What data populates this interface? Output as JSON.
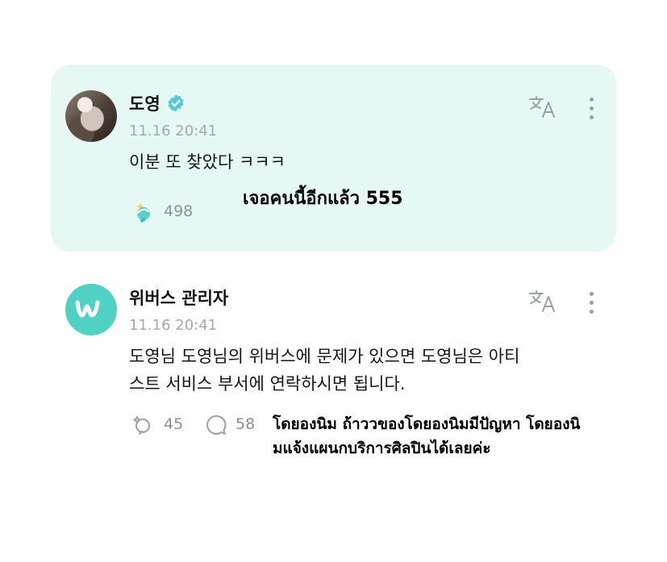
{
  "comment": {
    "author": "도영",
    "verified_icon": "verified-badge-icon",
    "timestamp": "11.16 20:41",
    "text": "이분 또 찾았다 ㅋㅋㅋ",
    "translation_overlay": "เจอคนนี้อีกแล้ว 555",
    "like_count": "498",
    "translate_icon": "translate-icon",
    "more_icon": "more-vertical-icon",
    "background": "#e6f8f4"
  },
  "reply": {
    "author": "위버스 관리자",
    "timestamp": "11.16 20:41",
    "text_line1": "도영님 도영님의 위버스에 문제가 있으면 도영님은 아티",
    "text_line2": "스트 서비스 부서에 연락하시면 됩니다.",
    "translation_overlay_line1": "โดยองนิม ถ้าววของโดยองนิมมีปัญหา โดยองนิ",
    "translation_overlay_line2": "มแจ้งแผนกบริการศิลปินได้เลยค่ะ",
    "like_count": "45",
    "comment_count": "58",
    "like_icon": "like-outline-icon",
    "comment_icon": "comment-bubble-icon",
    "translate_icon": "translate-icon",
    "more_icon": "more-vertical-icon",
    "avatar_color": "#4fd2c4"
  }
}
